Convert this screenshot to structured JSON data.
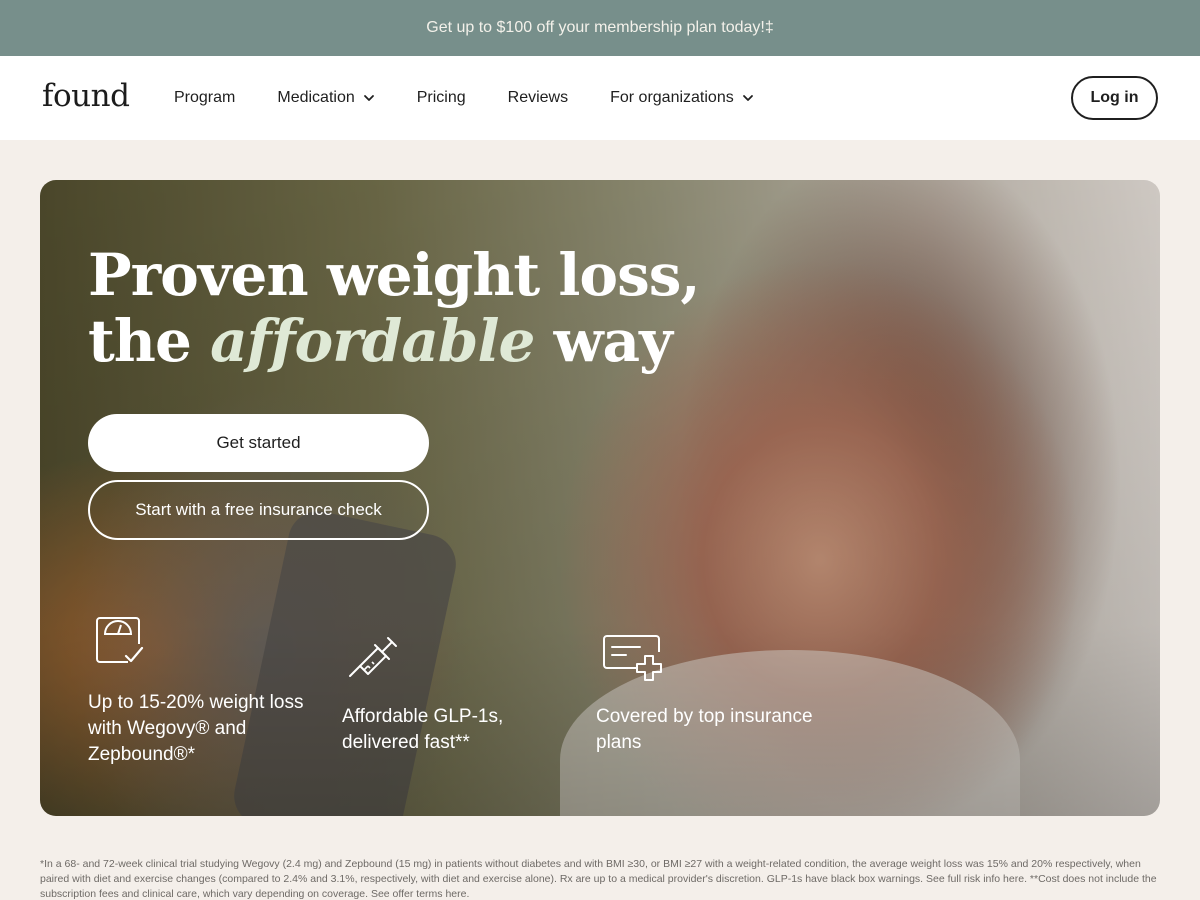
{
  "promo_banner": {
    "text": "Get up to $100 off your membership plan today!‡"
  },
  "nav": {
    "logo": "found",
    "items": [
      {
        "label": "Program",
        "has_dropdown": false
      },
      {
        "label": "Medication",
        "has_dropdown": true
      },
      {
        "label": "Pricing",
        "has_dropdown": false
      },
      {
        "label": "Reviews",
        "has_dropdown": false
      },
      {
        "label": "For organizations",
        "has_dropdown": true
      }
    ],
    "login_label": "Log in"
  },
  "hero": {
    "headline_line1": "Proven weight loss,",
    "headline_line2_pre": "the ",
    "headline_line2_em": "affordable",
    "headline_line2_post": " way",
    "primary_cta": "Get started",
    "secondary_cta": "Start with a free insurance check",
    "features": [
      {
        "icon": "scale-check-icon",
        "text": "Up to 15-20% weight loss with Wegovy® and Zepbound®*"
      },
      {
        "icon": "syringe-icon",
        "text": "Affordable GLP-1s, delivered fast**"
      },
      {
        "icon": "insurance-card-plus-icon",
        "text": "Covered by top insurance plans"
      }
    ]
  },
  "disclaimer": "*In a 68- and 72-week clinical trial studying Wegovy (2.4 mg) and Zepbound (15 mg) in patients without diabetes and with BMI ≥30, or BMI ≥27 with a weight-related condition, the average weight loss was 15% and 20% respectively, when paired with diet and exercise changes (compared to 2.4% and 3.1%, respectively, with diet and exercise alone). Rx are up to a medical provider's discretion. GLP-1s have black box warnings. See full risk info here. **Cost does not include the subscription fees and clinical care, which vary depending on coverage. See offer terms here.",
  "colors": {
    "promo_bg": "#778f8b",
    "page_bg": "#f4efea",
    "headline_accent": "#dfe9d6"
  }
}
